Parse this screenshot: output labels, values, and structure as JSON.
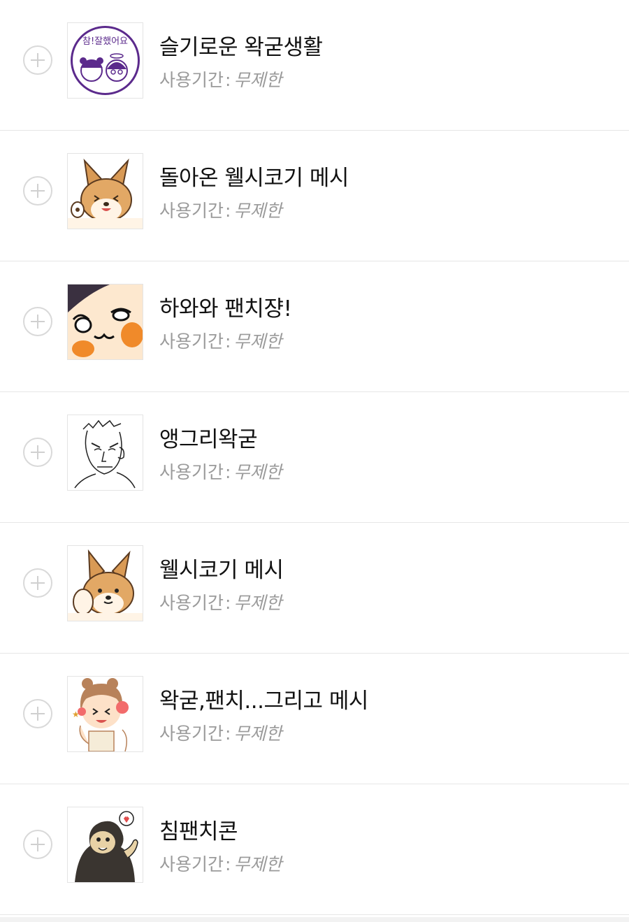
{
  "period_label": "사용기간",
  "period_separator": ":",
  "period_value": "무제한",
  "items": [
    {
      "title": "슬기로운 왁굳생활",
      "thumb_icon": "purple-stamp-icon",
      "thumb_text": "참!잘했어요"
    },
    {
      "title": "돌아온 웰시코기 메시",
      "thumb_icon": "corgi-wave-icon"
    },
    {
      "title": "하와와 팬치쟝!",
      "thumb_icon": "blush-face-icon"
    },
    {
      "title": "앵그리왁굳",
      "thumb_icon": "angry-sketch-icon"
    },
    {
      "title": "웰시코기 메시",
      "thumb_icon": "corgi-icon"
    },
    {
      "title": "왁굳,팬치...그리고 메시",
      "thumb_icon": "headset-kid-icon"
    },
    {
      "title": "침팬치콘",
      "thumb_icon": "chimpanzee-icon"
    }
  ],
  "colors": {
    "stamp_purple": "#5b2a8c",
    "corgi_orange": "#d99a55",
    "blush_orange": "#f08a2a",
    "chimp_dark": "#3a3530",
    "muted_gray": "#9a9a9a"
  }
}
